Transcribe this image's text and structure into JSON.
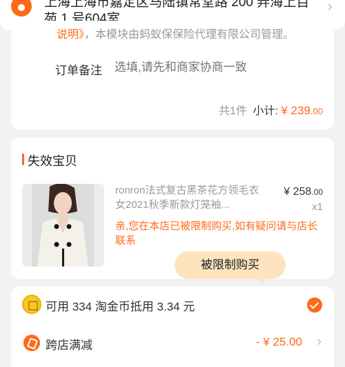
{
  "address": {
    "text": "上海上海市嘉定区马陆镇常堂路 200 弄海上百苑 1 号604室"
  },
  "order": {
    "faded_note_prefix": "说明》",
    "faded_note_text": "，本模块由蚂蚁保保险代理有限公司管理。",
    "remark_label": "订单备注",
    "remark_placeholder": "选填,请先和商家协商一致",
    "count_text": "共1件",
    "subtotal_label": "小计:",
    "currency": "¥",
    "subtotal_int": "239",
    "subtotal_dec": ".00"
  },
  "invalid_section": {
    "title": "失效宝贝",
    "product": {
      "title": "ronron法式复古黑茶花方领毛衣女2021秋季新款灯笼袖...",
      "currency": "¥",
      "price_int": "258",
      "price_dec": ".00",
      "qty": "x1"
    },
    "restriction_message": "亲,您在本店已被限制购买,如有疑问请与店长联系",
    "tooltip": "被限制购买"
  },
  "payment": {
    "coin_text": "可用 334 淘金币抵用 3.34 元",
    "coin_selected": true,
    "discount_label": "跨店满减",
    "discount_value": "- ¥ 25.00"
  },
  "colors": {
    "accent": "#ff6a1a",
    "tooltip_bg": "#fde4bf",
    "page_bg": "#f2f2f2"
  }
}
